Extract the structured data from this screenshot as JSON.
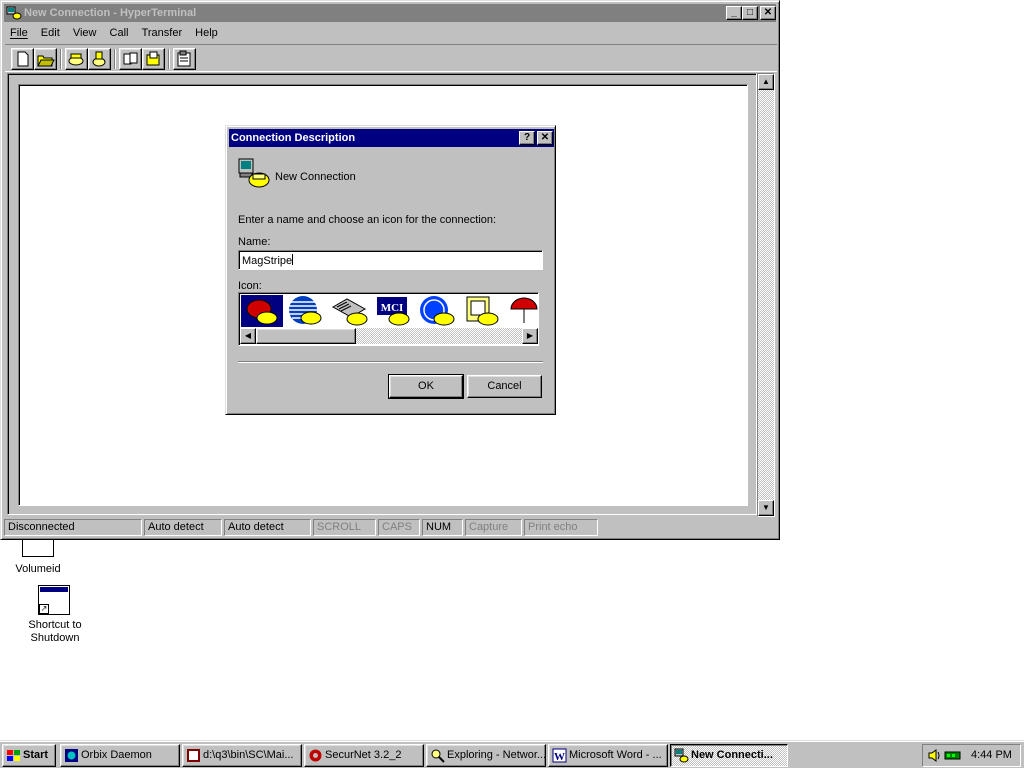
{
  "window": {
    "title": "New Connection - HyperTerminal",
    "min": "_",
    "max": "□",
    "close": "✕"
  },
  "menu": {
    "file": "File",
    "edit": "Edit",
    "view": "View",
    "call": "Call",
    "transfer": "Transfer",
    "help": "Help"
  },
  "toolbar": {
    "icons": [
      "new-icon",
      "open-icon",
      "connect-icon",
      "disconnect-icon",
      "send-icon",
      "receive-icon",
      "properties-icon"
    ]
  },
  "status": {
    "connection": "Disconnected",
    "detect1": "Auto detect",
    "detect2": "Auto detect",
    "scroll": "SCROLL",
    "caps": "CAPS",
    "num": "NUM",
    "capture": "Capture",
    "printecho": "Print echo"
  },
  "dialog": {
    "title": "Connection Description",
    "help": "?",
    "close": "✕",
    "header": "New Connection",
    "instruction": "Enter a name and choose an icon for the connection:",
    "name_label": "Name:",
    "name_value": "MagStripe",
    "icon_label": "Icon:",
    "mci_text": "MCI",
    "ok": "OK",
    "cancel": "Cancel"
  },
  "desktop": {
    "volumeid": "Volumeid",
    "shortcut_line1": "Shortcut to",
    "shortcut_line2": "Shutdown"
  },
  "taskbar": {
    "start": "Start",
    "tasks": [
      "Orbix Daemon",
      "d:\\q3\\bin\\SC\\Mai...",
      "SecurNet 3.2_2",
      "Exploring - Networ...",
      "Microsoft Word - ...",
      "New Connecti..."
    ],
    "clock": "4:44 PM"
  },
  "colors": {
    "active_title": "#000080",
    "inactive_title": "#808080",
    "face": "#c0c0c0"
  }
}
